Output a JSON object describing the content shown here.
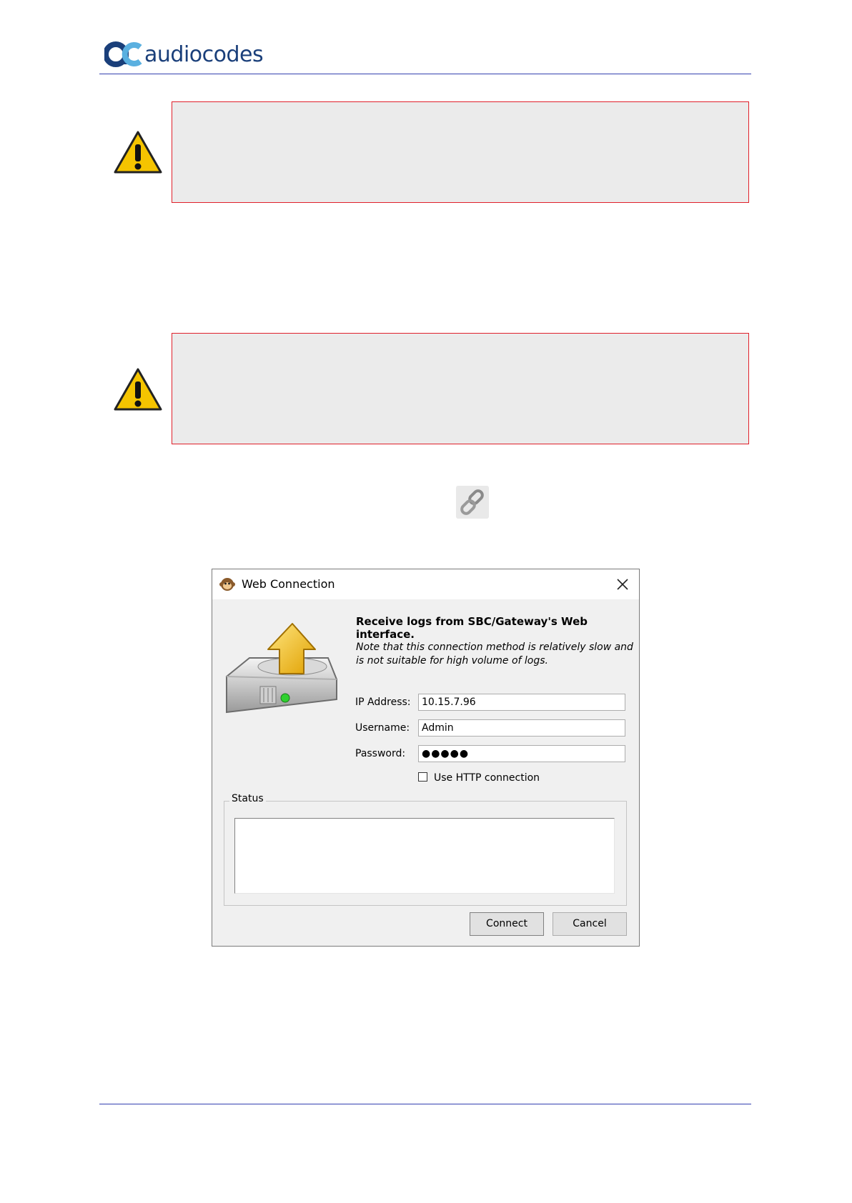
{
  "header": {
    "logo_text": "audiocodes"
  },
  "dialog": {
    "title": "Web Connection",
    "headline": "Receive logs from SBC/Gateway's Web interface.",
    "note_line1": "Note that this connection method is relatively slow and",
    "note_line2": "is not suitable for high volume of logs.",
    "ip_label": "IP Address:",
    "ip_value": "10.15.7.96",
    "username_label": "Username:",
    "username_value": "Admin",
    "password_label": "Password:",
    "password_value": "●●●●●",
    "http_checkbox_label": "Use HTTP connection",
    "http_checked": false,
    "status_label": "Status",
    "connect_label": "Connect",
    "cancel_label": "Cancel"
  },
  "icons": [
    "warning-icon",
    "chain-link-icon",
    "monkey-app-icon",
    "close-icon",
    "drive-upload-icon"
  ],
  "colors": {
    "accent": "#1a3f7a",
    "rule": "#3340b0",
    "note_border": "#e0202a",
    "note_bg": "#ebebeb"
  }
}
